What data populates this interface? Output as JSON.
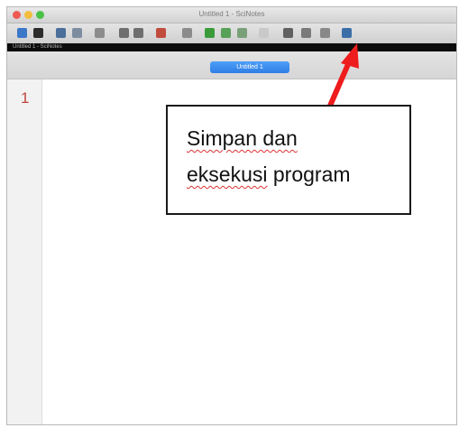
{
  "window": {
    "title": "Untitled 1 - SciNotes"
  },
  "toolbar": {
    "buttons": [
      {
        "icon": "new-file-icon",
        "color": "#3d77c8"
      },
      {
        "icon": "open-folder-icon",
        "color": "#2c2c2c"
      },
      {
        "icon": "save-icon",
        "color": "#4b6f9a"
      },
      {
        "icon": "save-as-icon",
        "color": "#7d8da0"
      },
      {
        "icon": "print-icon",
        "color": "#8c8c8c"
      },
      {
        "icon": "undo-icon",
        "color": "#6e6e6e"
      },
      {
        "icon": "redo-icon",
        "color": "#6e6e6e"
      },
      {
        "icon": "find-icon",
        "color": "#c14b3d"
      },
      {
        "icon": "copy-icon",
        "color": "#8b8b8b"
      },
      {
        "icon": "comment-icon",
        "color": "#3b9b3b"
      },
      {
        "icon": "indent-icon",
        "color": "#58a158"
      },
      {
        "icon": "run-icon",
        "color": "#7aa07a"
      },
      {
        "icon": "stop-icon",
        "color": "#c9c9c9"
      },
      {
        "icon": "save-and-execute-icon",
        "color": "#606060"
      },
      {
        "icon": "execute-icon",
        "color": "#7a7a7a"
      },
      {
        "icon": "tools-icon",
        "color": "#888888"
      },
      {
        "icon": "help-icon",
        "color": "#3c6fa8"
      }
    ]
  },
  "pathbar": {
    "text": "Untitled 1 - SciNotes"
  },
  "tabs": [
    {
      "label": "Untitled 1"
    }
  ],
  "editor": {
    "line_numbers": [
      "1"
    ]
  },
  "annotation": {
    "line1": "Simpan dan",
    "line2_part1": "eksekusi",
    "line2_part2": " program",
    "arrow_color": "#ee1c1c"
  },
  "colors": {
    "tab_active": "#3a8cf0",
    "line_number": "#c0463a"
  }
}
